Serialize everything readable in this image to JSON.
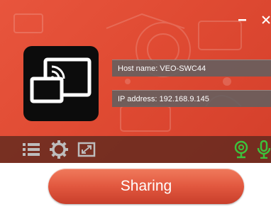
{
  "window": {
    "minimize_icon": "minimize-icon",
    "close_icon": "close-icon"
  },
  "device": {
    "host_name_label": "Host name: VEO-SWC44",
    "ip_address_label": "IP address: 192.168.9.145"
  },
  "toolbar": {
    "icons": [
      "list-icon",
      "gear-icon",
      "screen-expand-icon",
      "webcam-icon",
      "microphone-icon"
    ]
  },
  "share_button": {
    "label": "Sharing"
  },
  "colors": {
    "header_red": "#e04b33",
    "field_gray": "#626060",
    "toolbar_dark": "#5a281e",
    "icon_gray": "#bdbdbd",
    "icon_green": "#3cc23c",
    "button_red": "#e2583f"
  }
}
